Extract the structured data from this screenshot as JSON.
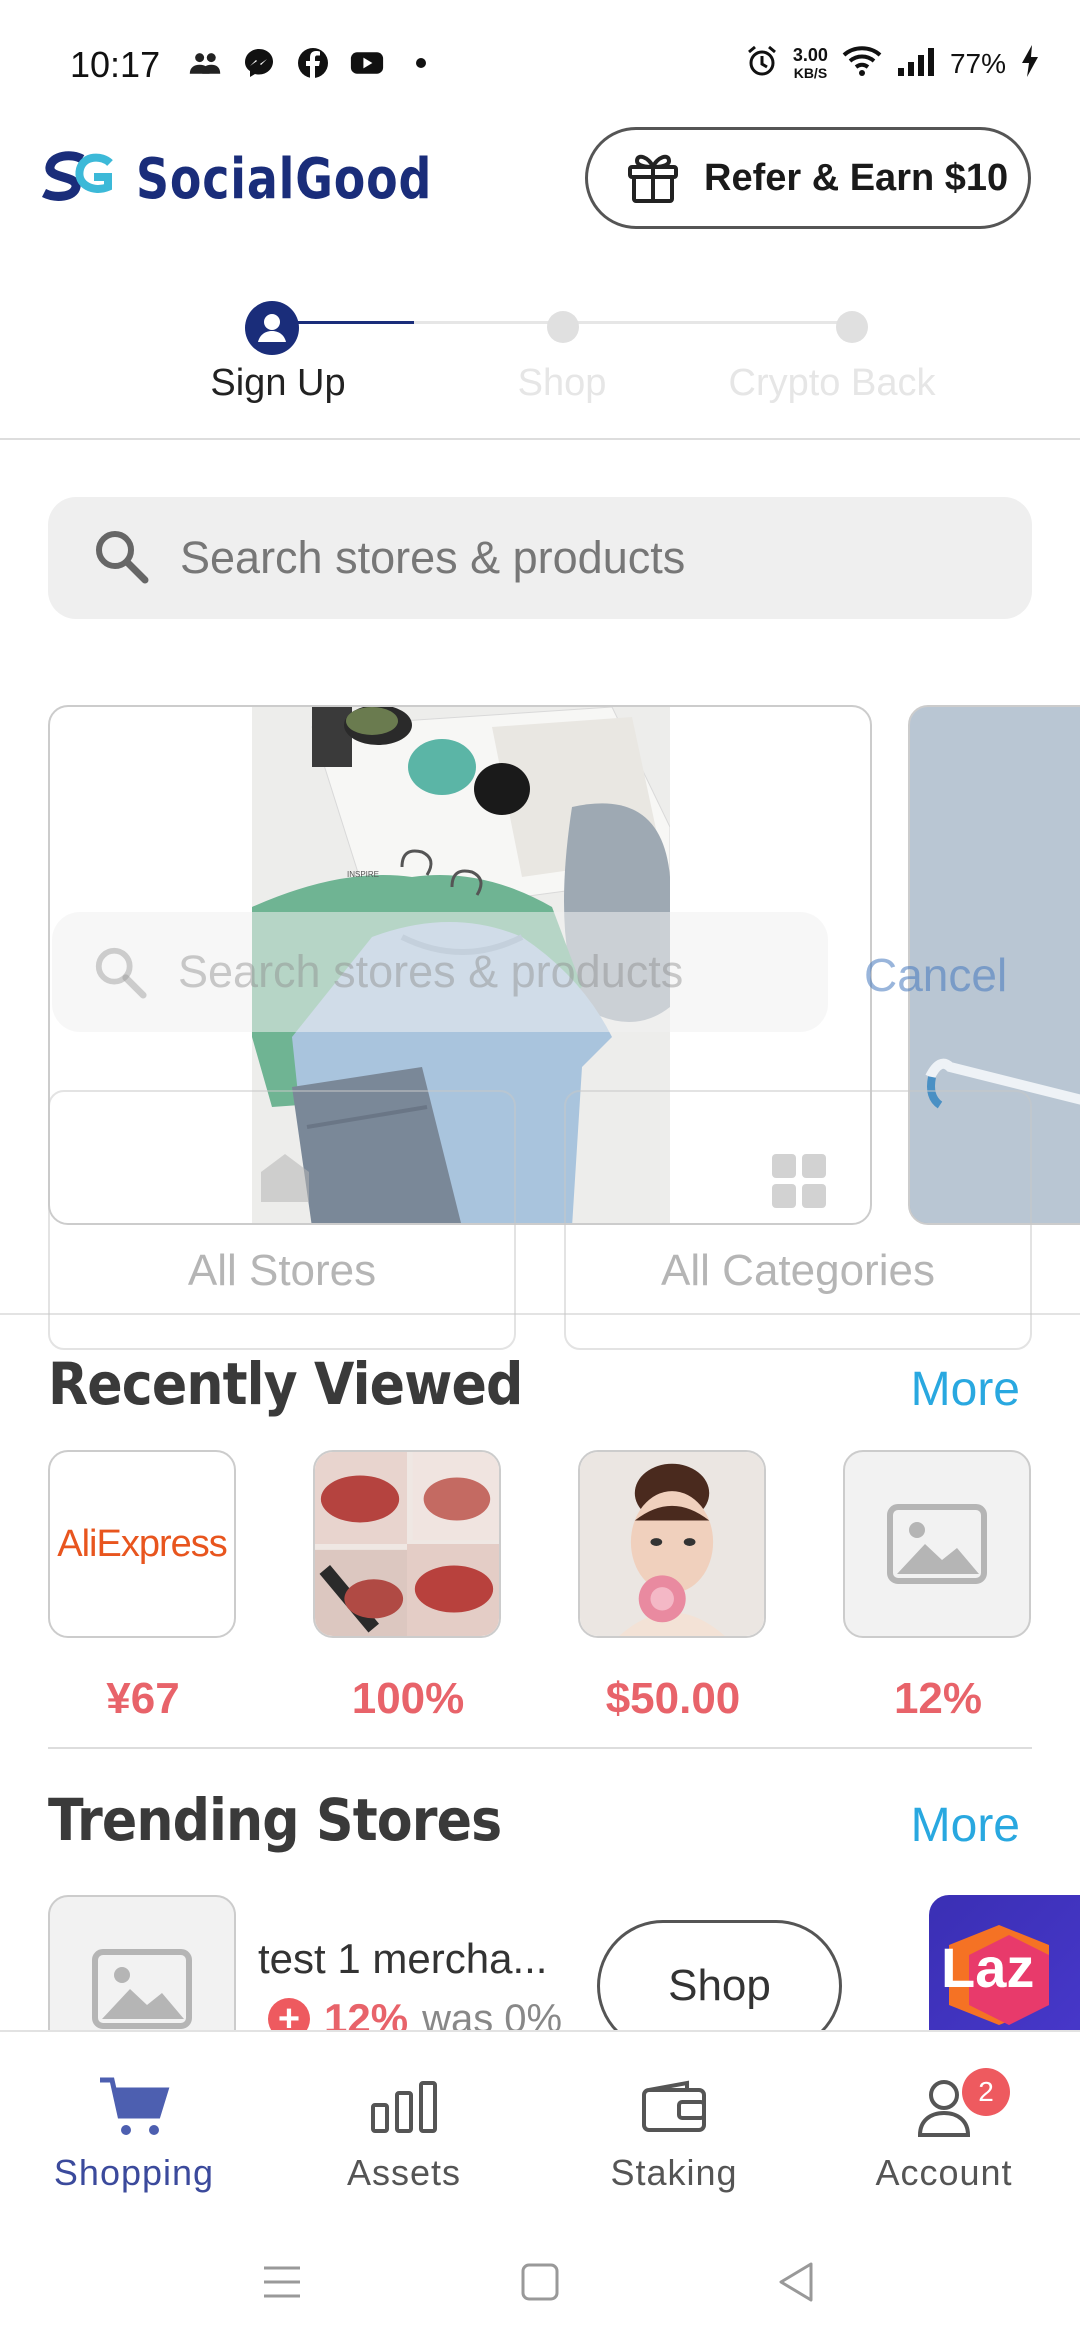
{
  "status_bar": {
    "time": "10:17",
    "net_speed": "3.00",
    "net_unit": "KB/S",
    "battery": "77%"
  },
  "header": {
    "brand": "SocialGood",
    "refer_label": "Refer & Earn $10"
  },
  "stepper": {
    "steps": [
      {
        "label": "Sign Up",
        "active": true
      },
      {
        "label": "Shop",
        "active": false
      },
      {
        "label": "Crypto Back",
        "active": false
      }
    ]
  },
  "search": {
    "placeholder": "Search stores & products"
  },
  "overlay": {
    "search_placeholder": "Search stores & products",
    "cancel_label": "Cancel",
    "tiles": [
      {
        "label": "All Stores",
        "icon": "store-icon"
      },
      {
        "label": "All Categories",
        "icon": "grid-icon"
      }
    ]
  },
  "recently_viewed": {
    "title": "Recently Viewed",
    "more_label": "More",
    "items": [
      {
        "value": "¥67",
        "thumb": "aliexpress-logo",
        "logo_text": "AliExpress"
      },
      {
        "value": "100%",
        "thumb": "lipstick-photo"
      },
      {
        "value": "$50.00",
        "thumb": "portrait-photo"
      },
      {
        "value": "12%",
        "thumb": "image-placeholder-icon"
      }
    ]
  },
  "trending_stores": {
    "title": "Trending Stores",
    "more_label": "More",
    "items": [
      {
        "name": "test 1 mercha...",
        "rate": "12%",
        "was": "was 0%",
        "shop_label": "Shop"
      }
    ],
    "partial_logo_text": "Laz"
  },
  "bottom_nav": {
    "items": [
      {
        "label": "Shopping",
        "icon": "cart-icon",
        "active": true
      },
      {
        "label": "Assets",
        "icon": "bar-chart-icon",
        "active": false
      },
      {
        "label": "Staking",
        "icon": "wallet-icon",
        "active": false
      },
      {
        "label": "Account",
        "icon": "user-icon",
        "active": false,
        "badge": "2"
      }
    ]
  },
  "colors": {
    "brand": "#1a2d7a",
    "accent_link": "#29a8e0",
    "price": "#e8636a",
    "nav_active": "#3b4a9c",
    "badge": "#ee5a5f"
  }
}
